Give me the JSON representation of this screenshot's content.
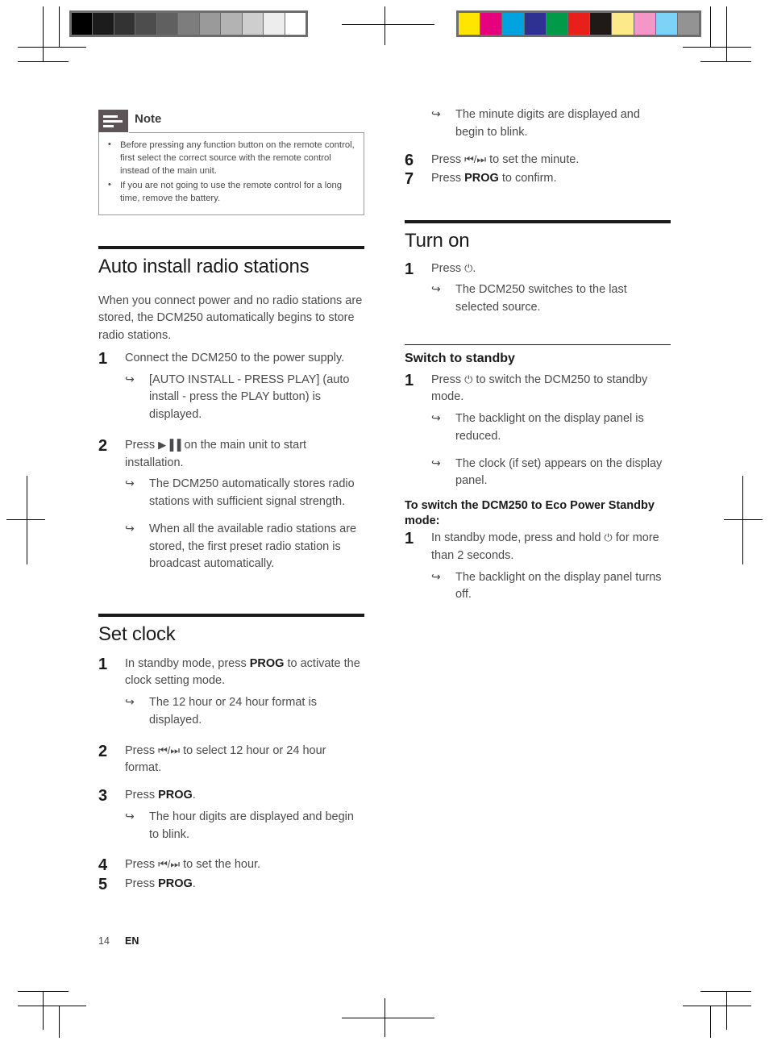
{
  "calibration": {
    "grayscale_label": "grayscale-calibration-strip",
    "grayscale": [
      "#000000",
      "#1c1c1c",
      "#333333",
      "#4d4d4d",
      "#606060",
      "#7d7d7d",
      "#9a9a9a",
      "#b3b3b3",
      "#cecece",
      "#ededed",
      "#ffffff"
    ],
    "color_label": "color-calibration-strip",
    "colors": [
      "#ffe500",
      "#e6007e",
      "#00a3e0",
      "#2e3192",
      "#009a49",
      "#e8201c",
      "#1f1a17",
      "#fbe98a",
      "#f497c8",
      "#7dd3f7",
      "#939393"
    ]
  },
  "note": {
    "title": "Note",
    "items": [
      "Before pressing any function button on the remote control, first select the correct source with the remote control instead of the main unit.",
      "If you are not going to use the remote control for a long time, remove the battery."
    ]
  },
  "left_column": {
    "sections": [
      {
        "heading": "Auto install radio stations",
        "intro": "When you connect power and no radio stations are stored, the DCM250 automatically begins to store radio stations.",
        "steps": [
          {
            "num": "1",
            "text": "Connect the DCM250 to the power supply.",
            "results": [
              "[AUTO INSTALL - PRESS PLAY] (auto install - press the PLAY button) is displayed."
            ]
          },
          {
            "num": "2",
            "text_before": "Press ",
            "symbol": "▶▐▐",
            "text_after": " on the main unit to start installation.",
            "results": [
              "The DCM250 automatically stores radio stations with sufficient signal strength.",
              "When all the available radio stations are stored, the first preset radio station is broadcast automatically."
            ]
          }
        ]
      },
      {
        "heading": "Set clock",
        "steps": [
          {
            "num": "1",
            "text_before": "In standby mode, press ",
            "bold": "PROG",
            "text_after": " to activate the clock setting mode.",
            "results": [
              "The 12 hour or 24 hour format is displayed."
            ]
          },
          {
            "num": "2",
            "text_before": "Press ",
            "symbol": "⏮/⏭",
            "text_after": " to select 12 hour or 24 hour format.",
            "results": []
          },
          {
            "num": "3",
            "text_before": "Press ",
            "bold": "PROG",
            "text_after": ".",
            "results": [
              "The hour digits are displayed and begin to blink."
            ]
          },
          {
            "num": "4",
            "text_before": "Press ",
            "symbol": "⏮/⏭",
            "text_after": " to set the hour.",
            "results": []
          },
          {
            "num": "5",
            "text_before": "Press ",
            "bold": "PROG",
            "text_after": ".",
            "results": []
          }
        ]
      }
    ]
  },
  "right_column": {
    "continued_result": "The minute digits are displayed and begin to blink.",
    "continued_steps": [
      {
        "num": "6",
        "text_before": "Press ",
        "symbol": "⏮/⏭",
        "text_after": " to set the minute.",
        "results": []
      },
      {
        "num": "7",
        "text_before": "Press ",
        "bold": "PROG",
        "text_after": " to confirm.",
        "results": []
      }
    ],
    "sections": [
      {
        "heading": "Turn on",
        "steps": [
          {
            "num": "1",
            "text_before": "Press ",
            "symbol": "⏻",
            "text_after": ".",
            "results": [
              "The DCM250 switches to the last selected source."
            ]
          }
        ]
      }
    ],
    "subsections": [
      {
        "heading": "Switch to standby",
        "steps": [
          {
            "num": "1",
            "text_before": "Press ",
            "symbol": "⏻",
            "text_after": " to switch the DCM250 to standby mode.",
            "results": [
              "The backlight on the display panel is reduced.",
              "The clock (if set) appears on the display panel."
            ]
          }
        ],
        "runin_heading": "To switch the DCM250 to Eco Power Standby mode:",
        "runin_steps": [
          {
            "num": "1",
            "text_before": "In standby mode, press and hold ",
            "symbol": "⏻",
            "text_after": " for more than 2 seconds.",
            "results": [
              "The backlight on the display panel turns off."
            ]
          }
        ]
      }
    ]
  },
  "footer": {
    "page_number": "14",
    "language": "EN"
  }
}
